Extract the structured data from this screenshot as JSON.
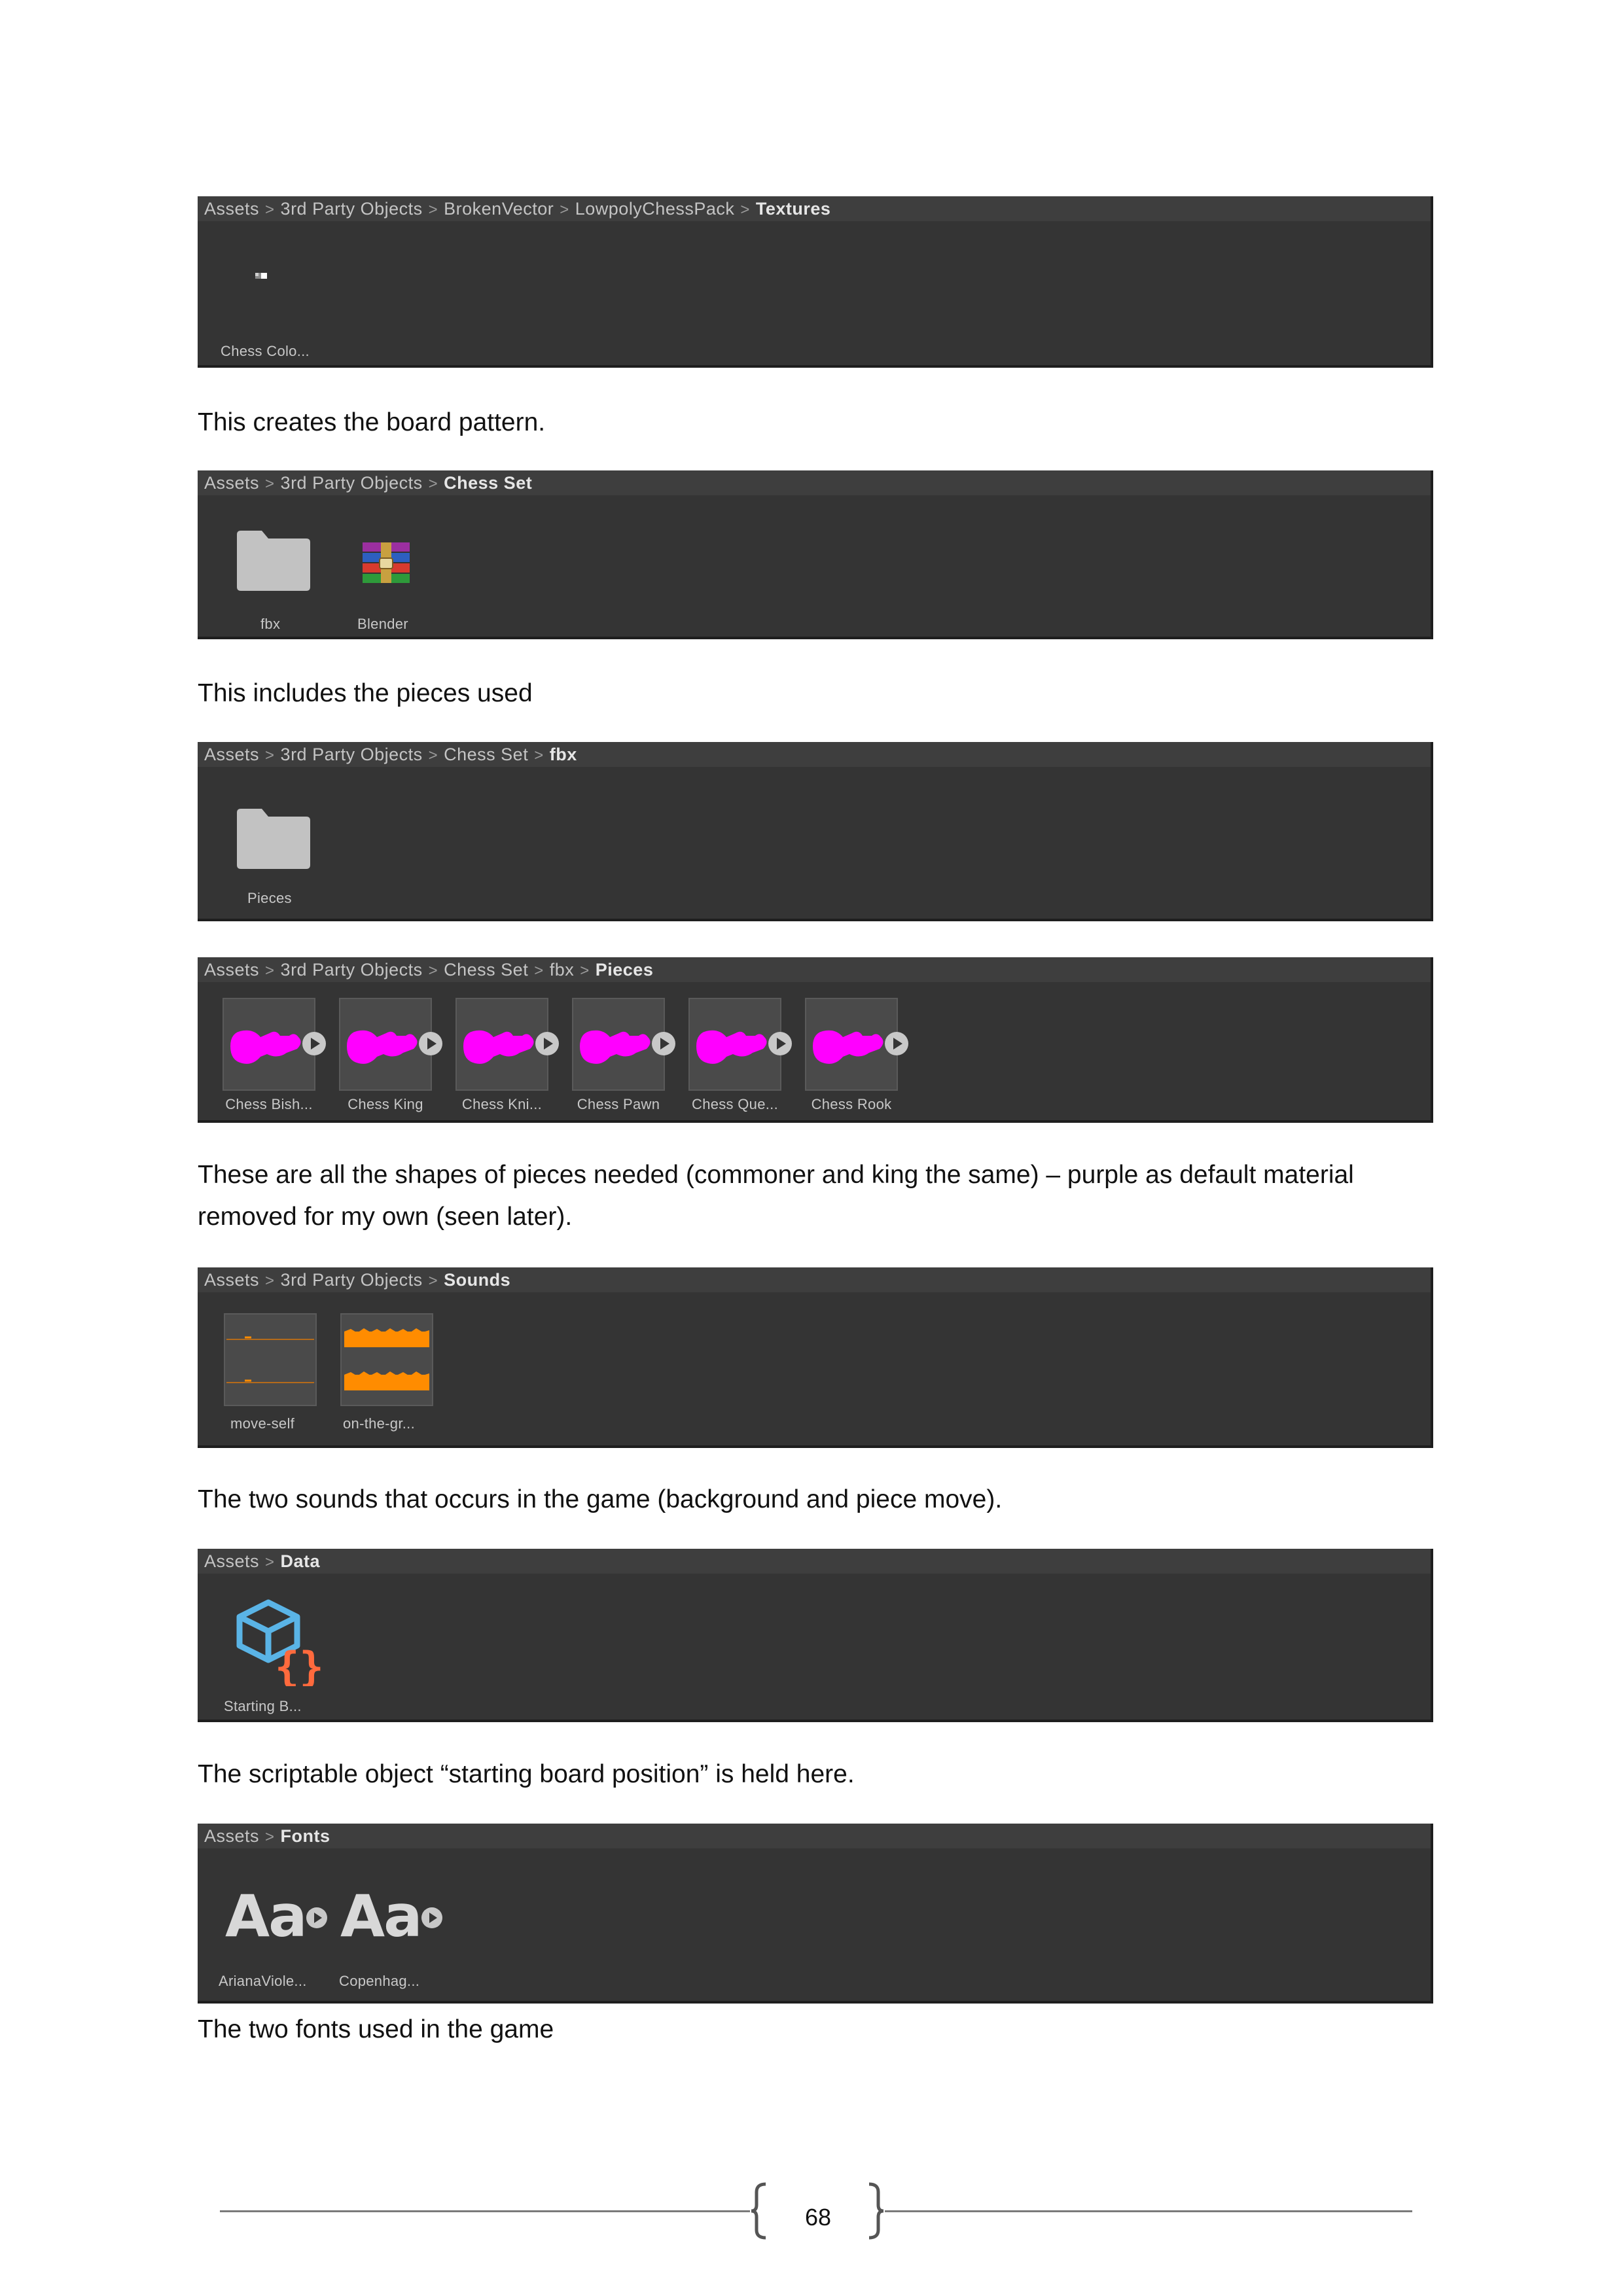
{
  "panels": {
    "textures": {
      "crumbs": [
        "Assets",
        "3rd Party Objects",
        "BrokenVector",
        "LowpolyChessPack"
      ],
      "current": "Textures",
      "items": [
        {
          "label": "Chess Colo...",
          "icon": "texture-icon"
        }
      ]
    },
    "chess_set": {
      "crumbs": [
        "Assets",
        "3rd Party Objects"
      ],
      "current": "Chess Set",
      "items": [
        {
          "label": "fbx",
          "icon": "folder-icon"
        },
        {
          "label": "Blender",
          "icon": "winrar-archive-icon"
        }
      ]
    },
    "fbx": {
      "crumbs": [
        "Assets",
        "3rd Party Objects",
        "Chess Set"
      ],
      "current": "fbx",
      "items": [
        {
          "label": "Pieces",
          "icon": "folder-icon"
        }
      ]
    },
    "pieces": {
      "crumbs": [
        "Assets",
        "3rd Party Objects",
        "Chess Set",
        "fbx"
      ],
      "current": "Pieces",
      "items": [
        {
          "label": "Chess Bish...",
          "icon": "model-prefab-icon"
        },
        {
          "label": "Chess King",
          "icon": "model-prefab-icon"
        },
        {
          "label": "Chess Kni...",
          "icon": "model-prefab-icon"
        },
        {
          "label": "Chess Pawn",
          "icon": "model-prefab-icon"
        },
        {
          "label": "Chess Que...",
          "icon": "model-prefab-icon"
        },
        {
          "label": "Chess Rook",
          "icon": "model-prefab-icon"
        }
      ]
    },
    "sounds": {
      "crumbs": [
        "Assets",
        "3rd Party Objects"
      ],
      "current": "Sounds",
      "items": [
        {
          "label": "move-self",
          "icon": "audio-waveform-icon"
        },
        {
          "label": "on-the-gr...",
          "icon": "audio-waveform-icon"
        }
      ]
    },
    "data": {
      "crumbs": [
        "Assets"
      ],
      "current": "Data",
      "items": [
        {
          "label": "Starting B...",
          "icon": "scriptable-object-icon"
        }
      ]
    },
    "fonts": {
      "crumbs": [
        "Assets"
      ],
      "current": "Fonts",
      "items": [
        {
          "label": "ArianaViole...",
          "icon": "font-asset-icon",
          "glyph": "Aa"
        },
        {
          "label": "Copenhag...",
          "icon": "font-asset-icon",
          "glyph": "Aa"
        }
      ]
    }
  },
  "paragraphs": {
    "p1": "This creates the board pattern.",
    "p2": "This includes the pieces used",
    "p3": "These are all the shapes of pieces needed (commoner and king the same) – purple as default material removed for my own (seen later).",
    "p4": "The two sounds that occurs in the game (background and piece move).",
    "p5": "The scriptable object “starting board position” is held here.",
    "p6": "The two fonts used in the game"
  },
  "footer": {
    "page_number": "68"
  },
  "colors": {
    "panel_bg": "#343434",
    "breadcrumb_bg": "#3e3e3e",
    "model_magenta": "#ff00ff",
    "audio_orange": "#ff8c00",
    "scriptable_blue": "#5ab4e6",
    "scriptable_orange": "#ff6a3d"
  }
}
